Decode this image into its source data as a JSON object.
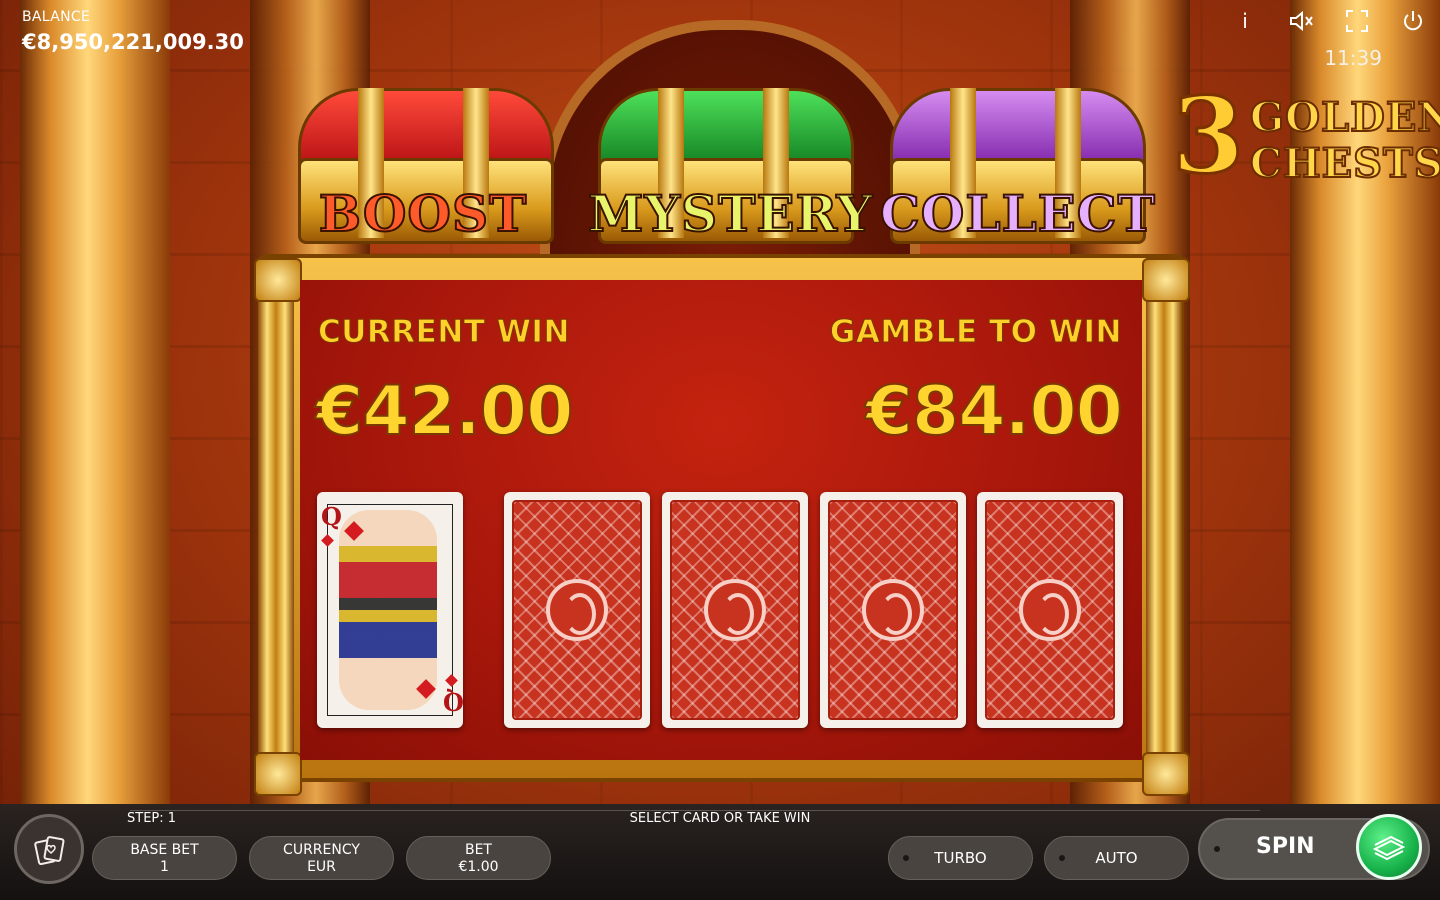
{
  "balance": {
    "label": "BALANCE",
    "value": "€8,950,221,009.30"
  },
  "top_icons": [
    "info-icon",
    "mute-icon",
    "fullscreen-icon",
    "power-icon"
  ],
  "clock": "11:39",
  "logo": {
    "number": "3",
    "line1": "GOLDEN",
    "line2": "CHESTS"
  },
  "chests": [
    {
      "label": "BOOST",
      "color": "#d8141a"
    },
    {
      "label": "MYSTERY",
      "color": "#1f9a2a"
    },
    {
      "label": "COLLECT",
      "color": "#a43bd0"
    }
  ],
  "gamble": {
    "current_win_label": "CURRENT WIN",
    "current_win_value": "€42.00",
    "gamble_label": "GAMBLE TO WIN",
    "gamble_value": "€84.00"
  },
  "revealed_card": {
    "rank": "Q",
    "suit": "diamonds"
  },
  "bottom": {
    "step": "STEP: 1",
    "message": "SELECT CARD OR TAKE WIN",
    "base_bet": {
      "label": "BASE BET",
      "value": "1"
    },
    "currency": {
      "label": "CURRENCY",
      "value": "EUR"
    },
    "bet": {
      "label": "BET",
      "value": "€1.00"
    },
    "turbo": "TURBO",
    "auto": "AUTO",
    "spin": "SPIN"
  }
}
